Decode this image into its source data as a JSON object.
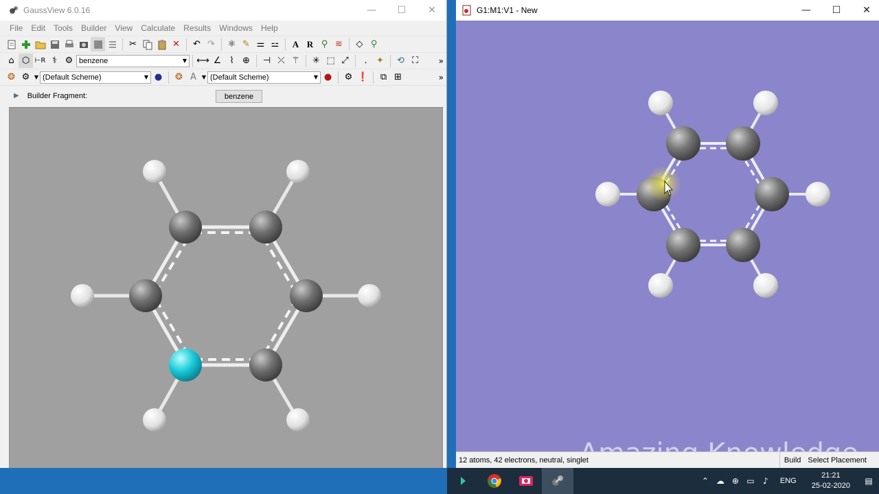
{
  "gaussview": {
    "title": "GaussView 6.0.16",
    "menu": [
      "File",
      "Edit",
      "Tools",
      "Builder",
      "View",
      "Calculate",
      "Results",
      "Windows",
      "Help"
    ],
    "fragment_combo": "benzene",
    "scheme_combo_1": "(Default Scheme)",
    "scheme_combo_2": "(Default Scheme)",
    "builder_fragment_label": "Builder Fragment:",
    "builder_fragment_button": "benzene",
    "overflow": "»",
    "molecule": {
      "carbon_color": "#707070",
      "hydrogen_color": "#eeeeee",
      "highlight_atom_color": "#19c8d8",
      "background": "#a0a0a0"
    }
  },
  "viewer": {
    "title": "G1:M1:V1 - New",
    "status_info": "12 atoms, 42 electrons, neutral, singlet",
    "status_mode": "Build",
    "status_placement": "Select Placement",
    "watermark": "Amazing Knowledge",
    "background": "#8b85cc"
  },
  "window_controls": {
    "minimize": "—",
    "maximize": "☐",
    "close": "✕"
  },
  "taskbar": {
    "apps": [
      "gaussview-icon",
      "chrome-icon",
      "video-icon",
      "gaussview-active-icon"
    ],
    "language": "ENG",
    "time": "21:21",
    "date": "25-02-2020"
  }
}
